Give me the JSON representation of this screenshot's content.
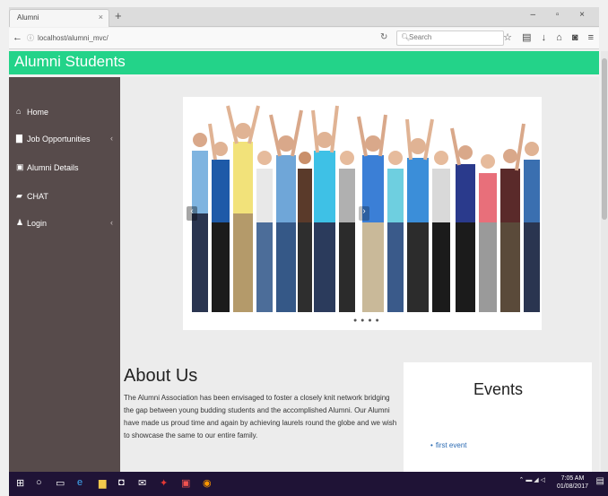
{
  "browser": {
    "tab_title": "Alumni",
    "tab_close": "×",
    "new_tab": "+",
    "window_controls": [
      "–",
      "▫",
      "×"
    ],
    "url": "localhost/alumni_mvc/",
    "search_placeholder": "Search",
    "toolbar_icons": [
      "star-icon",
      "library-icon",
      "download-icon",
      "home-icon",
      "pocket-icon",
      "menu-icon"
    ]
  },
  "site": {
    "title": "Alumni Students"
  },
  "sidebar": {
    "items": [
      {
        "label": "Home",
        "icon": "home-icon",
        "has_submenu": false
      },
      {
        "label": "Job Opportunities",
        "icon": "briefcase-icon",
        "has_submenu": true
      },
      {
        "label": "Alumni Details",
        "icon": "id-card-icon",
        "has_submenu": false
      },
      {
        "label": "CHAT",
        "icon": "chat-icon",
        "has_submenu": false
      },
      {
        "label": "Login",
        "icon": "user-icon",
        "has_submenu": true
      }
    ]
  },
  "about": {
    "heading": "About Us",
    "body": "The Alumni Association has been envisaged to foster a closely knit network bridging the gap between young budding students and the accomplished Alumni. Our Alumni have made us proud time and again by achieving laurels round the globe and we wish to showcase the same to our entire family."
  },
  "events": {
    "heading": "Events",
    "items": [
      "first event"
    ]
  },
  "taskbar": {
    "time": "7:05 AM",
    "date": "01/08/2017"
  },
  "colors": {
    "header": "#23d389",
    "sidebar": "#574b4b",
    "taskbar": "#1f1336",
    "link": "#2a6ab2"
  }
}
